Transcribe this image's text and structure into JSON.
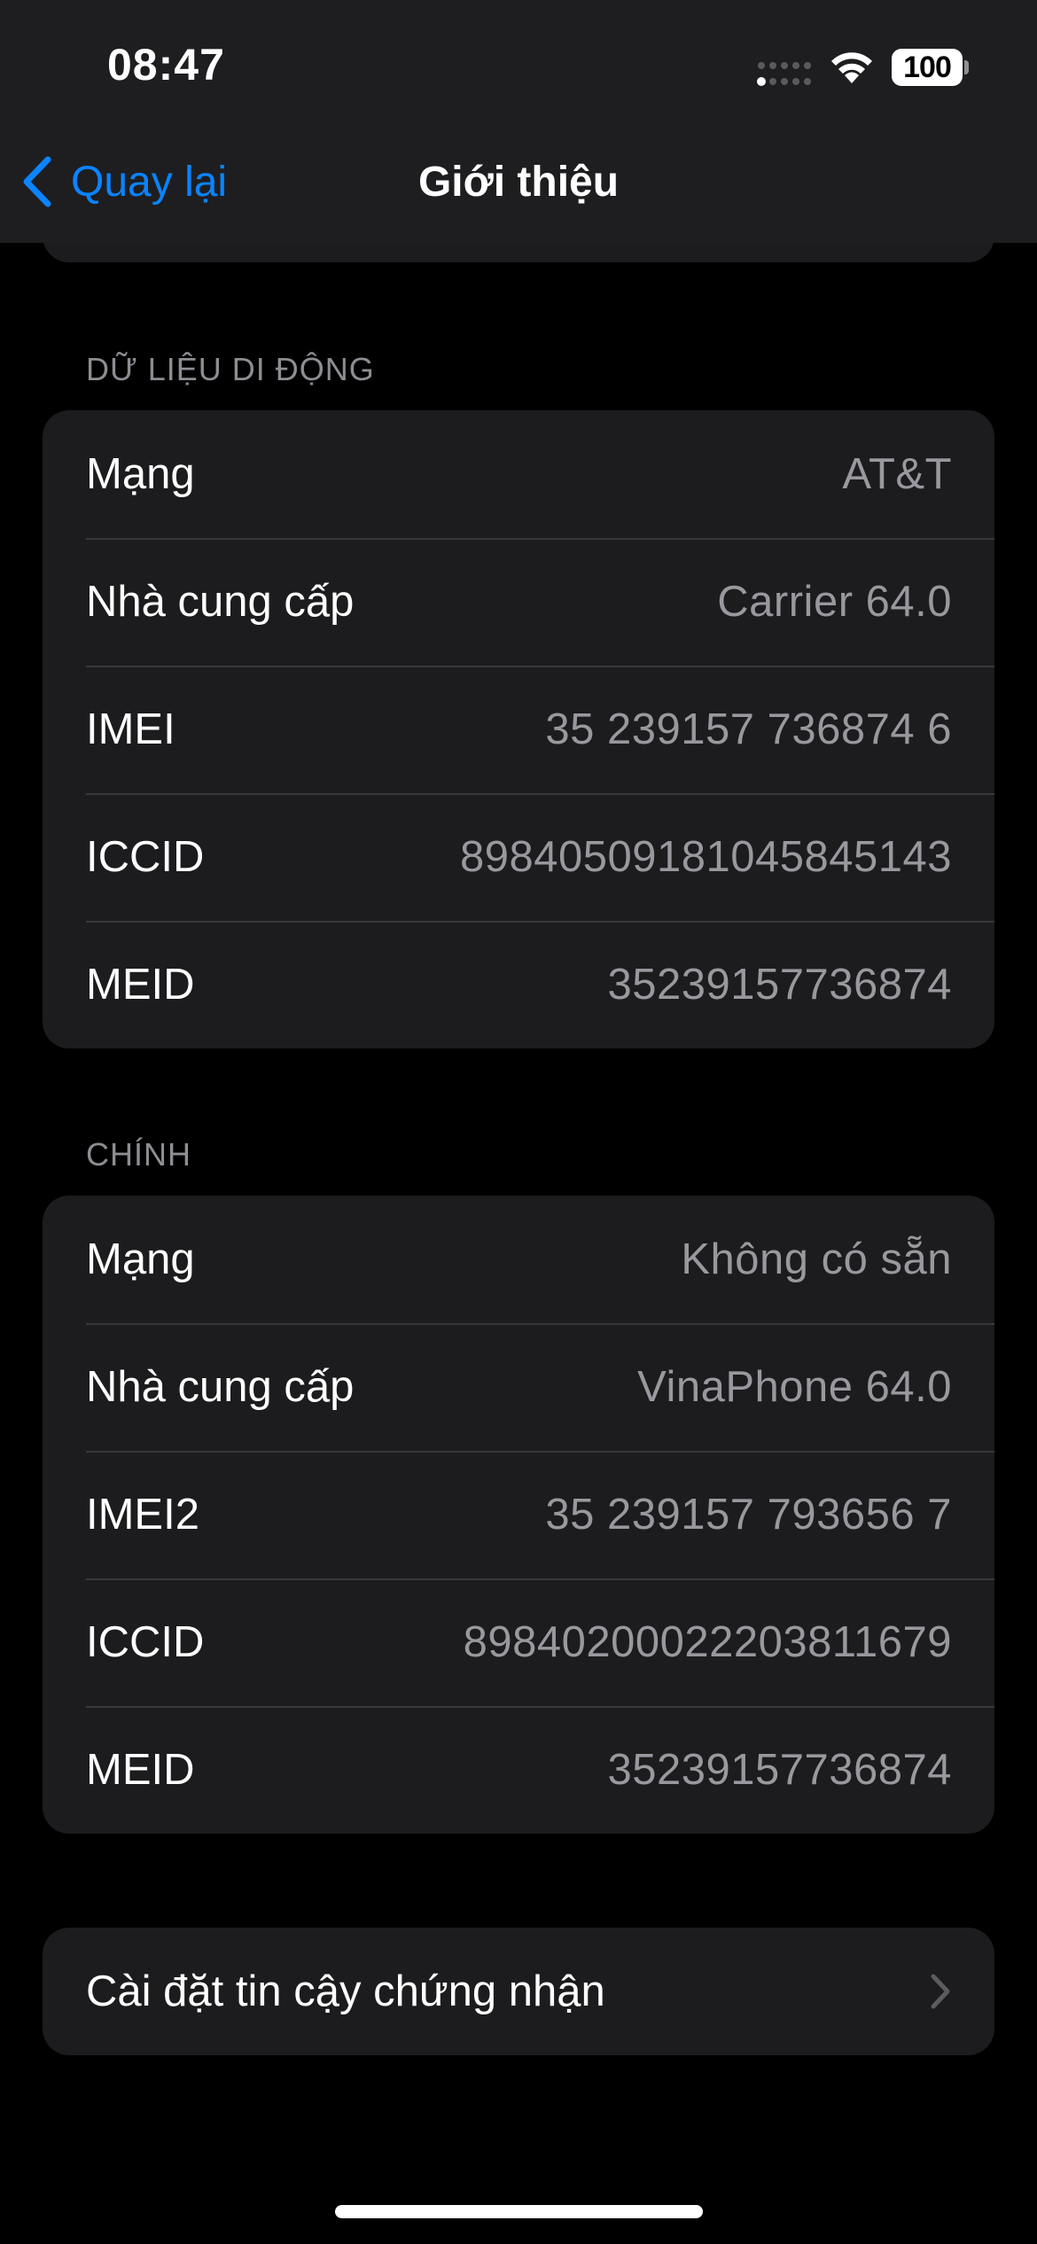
{
  "status_bar": {
    "time": "08:47",
    "battery": "100",
    "icons": [
      "cellular-signal-icon",
      "wifi-icon",
      "battery-icon"
    ]
  },
  "nav": {
    "back_label": "Quay lại",
    "title": "Giới thiệu"
  },
  "colors": {
    "accent": "#0a84ff",
    "background": "#000000",
    "card": "#1c1c1e",
    "secondary_text": "#98989e",
    "separator": "#38383a"
  },
  "sections": [
    {
      "header": "DỮ LIỆU DI ĐỘNG",
      "rows": [
        {
          "label": "Mạng",
          "value": "AT&T"
        },
        {
          "label": "Nhà cung cấp",
          "value": "Carrier 64.0"
        },
        {
          "label": "IMEI",
          "value": "35 239157 736874 6"
        },
        {
          "label": "ICCID",
          "value": "89840509181045845143"
        },
        {
          "label": "MEID",
          "value": "35239157736874"
        }
      ]
    },
    {
      "header": "CHÍNH",
      "rows": [
        {
          "label": "Mạng",
          "value": "Không có sẵn"
        },
        {
          "label": "Nhà cung cấp",
          "value": "VinaPhone 64.0"
        },
        {
          "label": "IMEI2",
          "value": "35 239157 793656 7"
        },
        {
          "label": "ICCID",
          "value": "89840200022203811679"
        },
        {
          "label": "MEID",
          "value": "35239157736874"
        }
      ]
    }
  ],
  "certificate_trust": {
    "label": "Cài đặt tin cậy chứng nhận",
    "icon": "chevron-right-icon"
  }
}
